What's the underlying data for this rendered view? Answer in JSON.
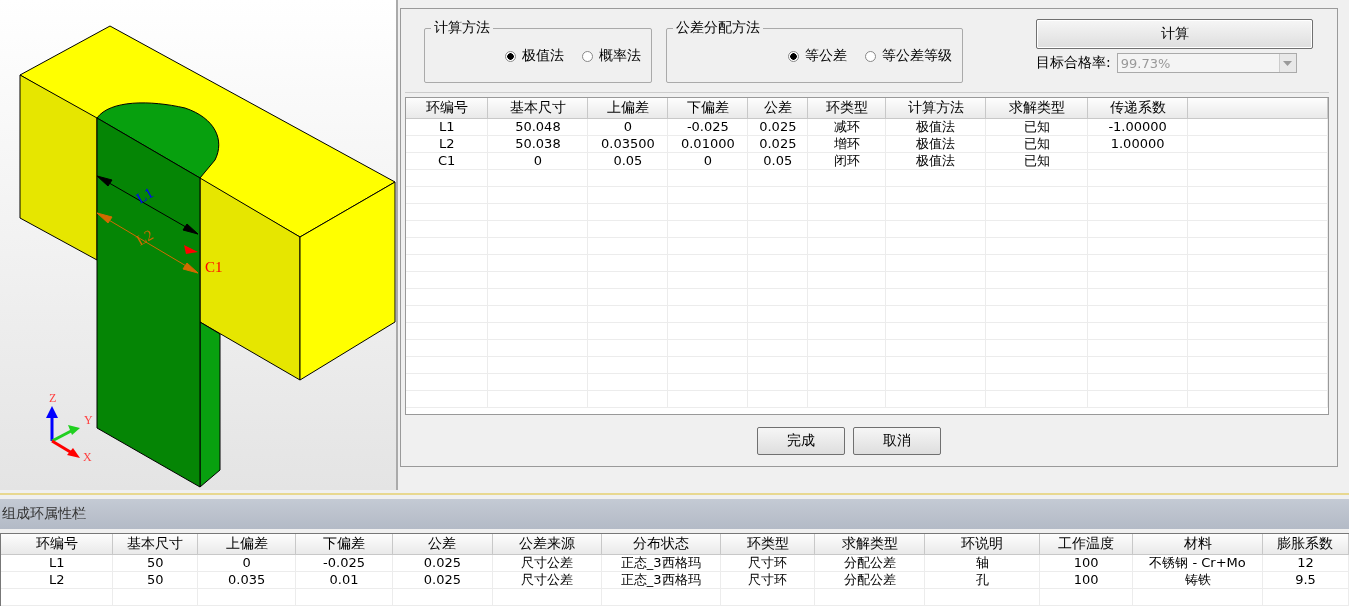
{
  "viewport": {
    "dimension_labels": [
      {
        "text": "L1",
        "color": "#0000ff"
      },
      {
        "text": "L2",
        "color": "#d26a00"
      },
      {
        "text": "C1",
        "color": "#ff0000"
      }
    ],
    "axes": [
      "X",
      "Y",
      "Z"
    ]
  },
  "calc_method": {
    "title": "计算方法",
    "options": [
      {
        "label": "极值法",
        "selected": true
      },
      {
        "label": "概率法",
        "selected": false
      }
    ]
  },
  "allocation_method": {
    "title": "公差分配方法",
    "options": [
      {
        "label": "等公差",
        "selected": true
      },
      {
        "label": "等公差等级",
        "selected": false
      }
    ]
  },
  "calculate_button": "计算",
  "target_rate": {
    "label": "目标合格率:",
    "value": "99.73%",
    "disabled": true
  },
  "result_table": {
    "columns": [
      "环编号",
      "基本尺寸",
      "上偏差",
      "下偏差",
      "公差",
      "环类型",
      "计算方法",
      "求解类型",
      "传递系数"
    ],
    "rows": [
      [
        "L1",
        "50.048",
        "0",
        "-0.025",
        "0.025",
        "减环",
        "极值法",
        "已知",
        "-1.00000"
      ],
      [
        "L2",
        "50.038",
        "0.03500",
        "0.01000",
        "0.025",
        "增环",
        "极值法",
        "已知",
        "1.00000"
      ],
      [
        "C1",
        "0",
        "0.05",
        "0",
        "0.05",
        "闭环",
        "极值法",
        "已知",
        ""
      ]
    ]
  },
  "buttons": [
    "完成",
    "取消"
  ],
  "properties_panel": {
    "title": "组成环属性栏",
    "columns": [
      "环编号",
      "基本尺寸",
      "上偏差",
      "下偏差",
      "公差",
      "公差来源",
      "分布状态",
      "环类型",
      "求解类型",
      "环说明",
      "工作温度",
      "材料",
      "膨胀系数"
    ],
    "rows": [
      [
        "L1",
        "50",
        "0",
        "-0.025",
        "0.025",
        "尺寸公差",
        "正态_3西格玛",
        "尺寸环",
        "分配公差",
        "轴",
        "100",
        "不锈钢 - Cr+Mo",
        "12"
      ],
      [
        "L2",
        "50",
        "0.035",
        "0.01",
        "0.025",
        "尺寸公差",
        "正态_3西格玛",
        "尺寸环",
        "分配公差",
        "孔",
        "100",
        "铸铁",
        "9.5"
      ]
    ]
  }
}
